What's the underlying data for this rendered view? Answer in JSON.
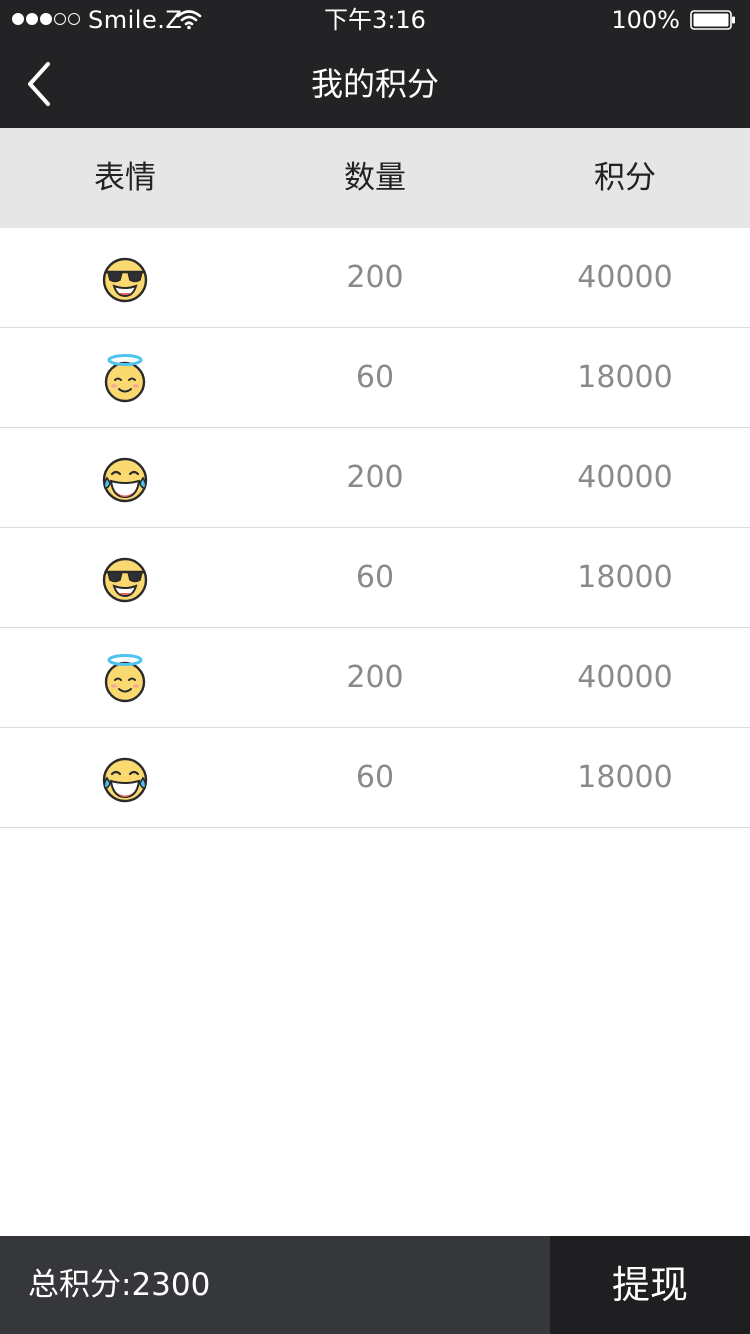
{
  "status_bar": {
    "carrier": "Smile.Z",
    "time": "下午3:16",
    "battery": "100%",
    "signal_icon": "signal-dots-icon",
    "wifi_icon": "wifi-icon",
    "battery_icon": "battery-icon"
  },
  "nav": {
    "back_icon": "chevron-left-icon",
    "title": "我的积分"
  },
  "table": {
    "headers": [
      "表情",
      "数量",
      "积分"
    ],
    "rows": [
      {
        "emoji": "sunglasses-face-icon",
        "count": "200",
        "points": "40000"
      },
      {
        "emoji": "halo-face-icon",
        "count": "60",
        "points": "18000"
      },
      {
        "emoji": "tears-of-joy-face-icon",
        "count": "200",
        "points": "40000"
      },
      {
        "emoji": "sunglasses-face-icon",
        "count": "60",
        "points": "18000"
      },
      {
        "emoji": "halo-face-icon",
        "count": "200",
        "points": "40000"
      },
      {
        "emoji": "tears-of-joy-face-icon",
        "count": "60",
        "points": "18000"
      }
    ]
  },
  "footer": {
    "total_label": "总积分:2300",
    "withdraw_label": "提现"
  },
  "colors": {
    "nav_background": "#232326",
    "table_header_background": "#e6e6e6",
    "total_bar_background": "#36373b",
    "withdraw_background": "#1f1f21",
    "emoji_yellow": "#fbd971",
    "halo_blue": "#4dc3f0"
  }
}
